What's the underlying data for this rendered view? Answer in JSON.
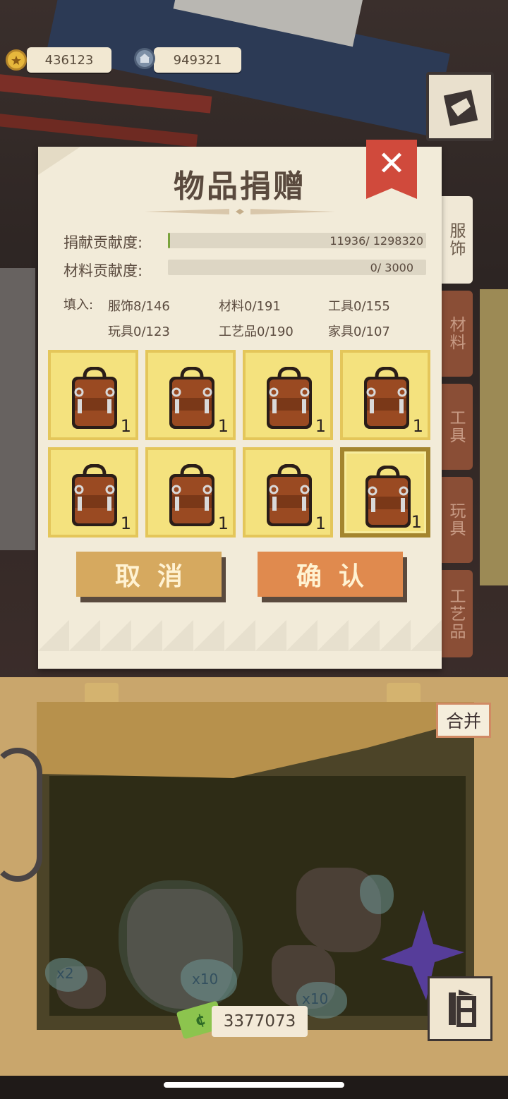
{
  "currency": {
    "gold_amount": "436123",
    "gem_amount": "949321"
  },
  "dialog": {
    "title": "物品捐赠",
    "donation_label": "捐献贡献度:",
    "donation_progress_text": "11936/ 1298320",
    "donation_progress_value": 11936,
    "donation_progress_max": 1298320,
    "material_label": "材料贡献度:",
    "material_progress_text": "0/ 3000",
    "material_progress_value": 0,
    "material_progress_max": 3000,
    "fill_prefix": "填入:",
    "fill_stats": [
      "服饰8/146",
      "材料0/191",
      "工具0/155",
      "玩具0/123",
      "工艺品0/190",
      "家具0/107"
    ],
    "items": [
      {
        "icon": "backpack-icon",
        "count": "1"
      },
      {
        "icon": "backpack-icon",
        "count": "1"
      },
      {
        "icon": "backpack-icon",
        "count": "1"
      },
      {
        "icon": "backpack-icon",
        "count": "1"
      },
      {
        "icon": "backpack-icon",
        "count": "1"
      },
      {
        "icon": "backpack-icon",
        "count": "1"
      },
      {
        "icon": "backpack-icon",
        "count": "1"
      },
      {
        "icon": "backpack-icon",
        "count": "1",
        "selected": true
      }
    ],
    "cancel_label": "取消",
    "confirm_label": "确认"
  },
  "side_tabs": [
    "服饰",
    "材料",
    "工具",
    "玩具",
    "工艺品"
  ],
  "merge_label": "合并",
  "money_amount": "3377073",
  "bag_badges": [
    "x2",
    "x10",
    "x10"
  ],
  "colors": {
    "slot_fill": "#f4e27e",
    "close_red": "#d04a3c",
    "confirm_orange": "#e08a4e",
    "cancel_tan": "#d6a95f",
    "progress_green": "#7aa33c"
  }
}
